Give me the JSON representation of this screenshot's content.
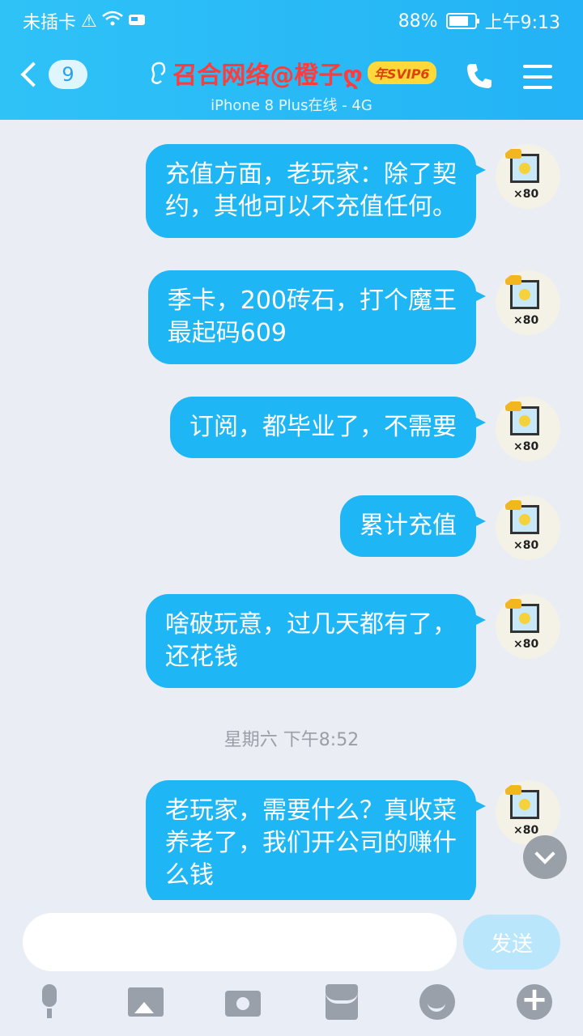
{
  "status_bar": {
    "carrier": "未插卡",
    "battery": "88%",
    "time": "上午9:13"
  },
  "header": {
    "unread_count": "9",
    "title": "召合网络@橙子ღ",
    "vip_badge": "年SVIP6",
    "subtitle": "iPhone 8 Plus在线 - 4G"
  },
  "messages": [
    {
      "text": "充值方面，老玩家：除了契约，其他可以不充值任何。",
      "lines": [
        "充值方面，老玩家：除了契",
        "约，其他可以不充值任何。"
      ],
      "avatar_badge": "×80"
    },
    {
      "text": "季卡，200砖石，打个魔王最起码609",
      "lines": [
        "季卡，200砖石，打个魔王",
        "最起码609"
      ],
      "avatar_badge": "×80"
    },
    {
      "text": "订阅，都毕业了，不需要",
      "lines": [
        "订阅，都毕业了，不需要"
      ],
      "avatar_badge": "×80"
    },
    {
      "text": "累计充值",
      "lines": [
        "累计充值"
      ],
      "avatar_badge": "×80"
    },
    {
      "text": "啥破玩意，过几天都有了，还花钱",
      "lines": [
        "啥破玩意，过几天都有了，",
        "还花钱"
      ],
      "avatar_badge": "×80"
    },
    {
      "text": "老玩家，需要什么？真收菜养老了，我们开公司的赚什么钱",
      "lines": [
        "老玩家，需要什么？真收菜",
        "养老了，我们开公司的赚什",
        "么钱"
      ],
      "avatar_badge": "×80"
    }
  ],
  "timestamp": "星期六 下午8:52",
  "input": {
    "placeholder": "",
    "send_label": "发送"
  },
  "colors": {
    "header_bg": "#23b3f6",
    "bubble_bg": "#1fb6f6",
    "title_color": "#ff3b3b"
  }
}
